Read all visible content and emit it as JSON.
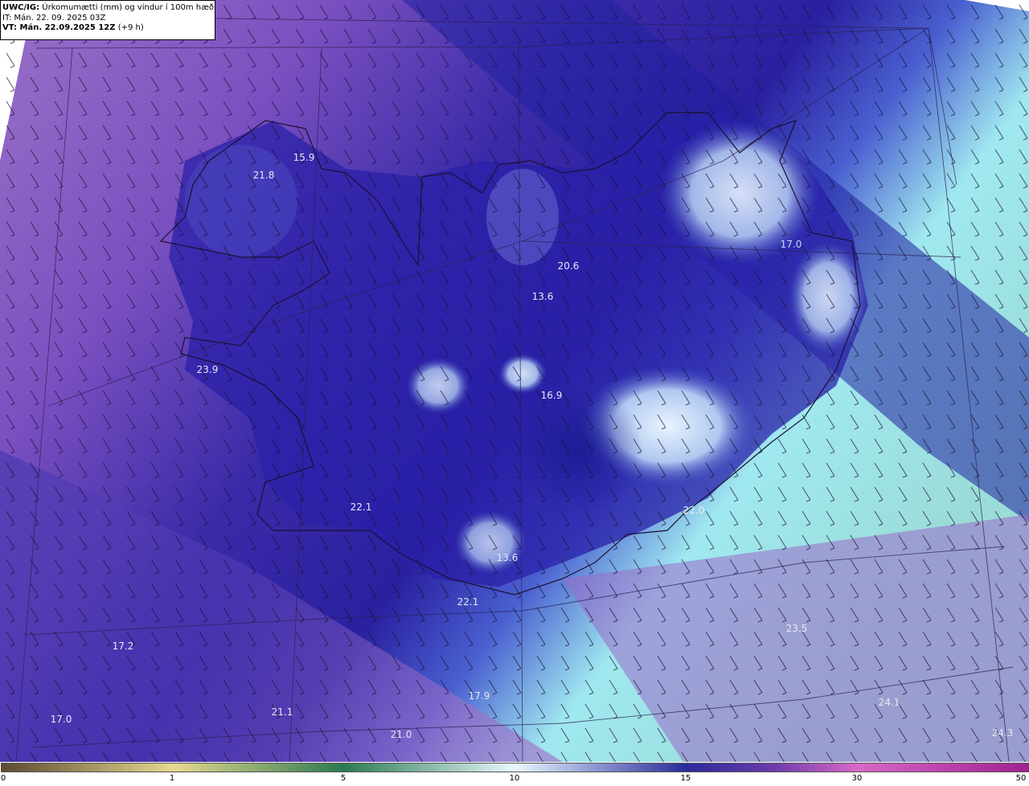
{
  "header": {
    "model_prefix": "UWC/IG:",
    "title": " Úrkomumætti (mm) og vindur í 100m hæð",
    "it_line": "IT: Mán. 22. 09. 2025 03Z",
    "vt_prefix": "VT: Mán. 22.09.2025 12Z",
    "vt_suffix": " (+9 h)"
  },
  "stations": [
    {
      "value": "15.9"
    },
    {
      "value": "21.8"
    },
    {
      "value": "20.6"
    },
    {
      "value": "13.6"
    },
    {
      "value": "23.9"
    },
    {
      "value": "16.9"
    },
    {
      "value": "22.1"
    },
    {
      "value": "22.0"
    },
    {
      "value": "13.6"
    },
    {
      "value": "22.1"
    },
    {
      "value": "23.5"
    },
    {
      "value": "17.2"
    },
    {
      "value": "17.9"
    },
    {
      "value": "21.1"
    },
    {
      "value": "17.0"
    },
    {
      "value": "21.0"
    },
    {
      "value": "24.1"
    },
    {
      "value": "24.3"
    },
    {
      "value": "17.0"
    }
  ],
  "colorbar": {
    "ticks": [
      "0",
      "1",
      "5",
      "10",
      "15",
      "30",
      "50"
    ],
    "colors": {
      "c0": "#5a4a30",
      "c1": "#e8d890",
      "c5": "#2a7a50",
      "c10": "#e8f8ff",
      "c15": "#2a2a9a",
      "c20": "#6a3aaa",
      "c30": "#d868c8",
      "c50": "#a02090"
    }
  }
}
